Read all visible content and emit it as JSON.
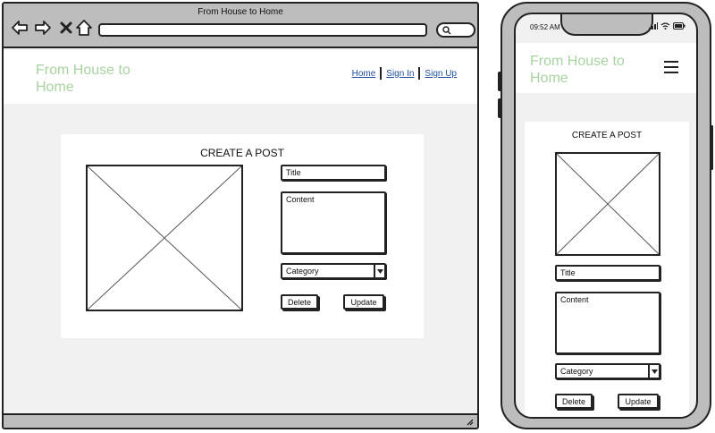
{
  "desktop": {
    "window_title": "From House to Home",
    "logo": "From House to Home",
    "nav": {
      "home": "Home",
      "sign_in": "Sign In",
      "sign_up": "Sign Up"
    },
    "form": {
      "title": "CREATE A POST",
      "title_placeholder": "Title",
      "content_placeholder": "Content",
      "category_label": "Category",
      "delete_label": "Delete",
      "update_label": "Update"
    }
  },
  "mobile": {
    "time": "09:52 AM",
    "logo": "From House to Home",
    "form": {
      "title": "CREATE A POST",
      "title_placeholder": "Title",
      "content_placeholder": "Content",
      "category_label": "Category",
      "delete_label": "Delete",
      "update_label": "Update"
    }
  },
  "colors": {
    "logo": "#a8d3a0",
    "link": "#1f4f9e",
    "chrome": "#bdbdbd",
    "canvas": "#f1f1f1"
  },
  "icons": [
    "back-arrow-icon",
    "forward-arrow-icon",
    "close-icon",
    "home-icon",
    "search-icon",
    "chevron-down-icon",
    "hamburger-menu-icon",
    "signal-icon",
    "wifi-icon",
    "battery-icon"
  ]
}
